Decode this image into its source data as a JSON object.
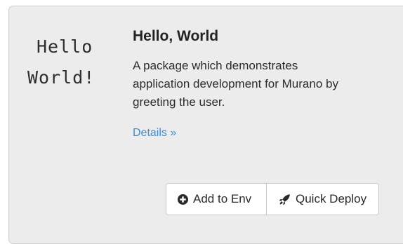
{
  "package": {
    "logo_line1": "Hello",
    "logo_line2": "World!",
    "title": "Hello, World",
    "description": "A package which demonstrates application development for Murano by greeting the user.",
    "details_link": "Details »"
  },
  "actions": {
    "add_label": "Add to Env",
    "add_icon": "plus-circle-icon",
    "deploy_label": "Quick Deploy",
    "deploy_icon": "rocket-icon"
  },
  "colors": {
    "card_background": "#ececec",
    "link": "#3a8fd0",
    "button_background": "#ffffff"
  }
}
